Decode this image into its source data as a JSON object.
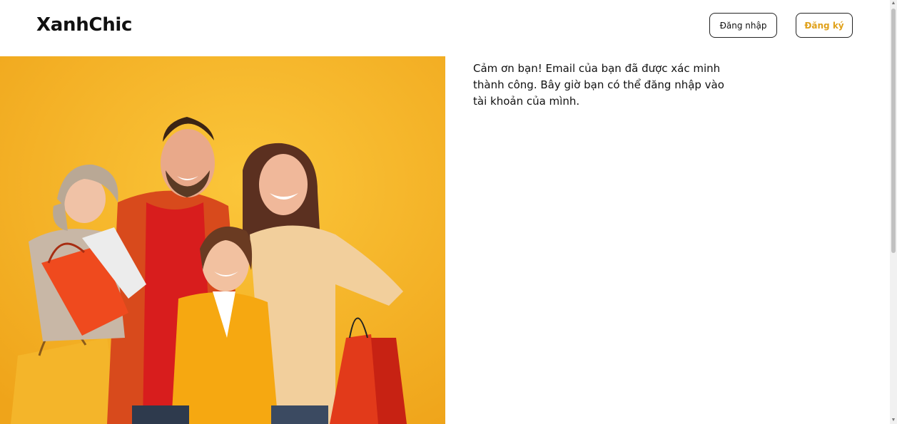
{
  "header": {
    "logo": "XanhChic",
    "login_label": "Đăng nhập",
    "register_label": "Đăng ký"
  },
  "main": {
    "message": "Cảm ơn bạn! Email của bạn đã được xác minh thành công. Bây giờ bạn có thể đăng nhập vào tài khoản của mình."
  },
  "hero": {
    "image": "family-shopping-photo"
  },
  "colors": {
    "accent": "#e0a11b",
    "hero_background": "#f6b623"
  }
}
